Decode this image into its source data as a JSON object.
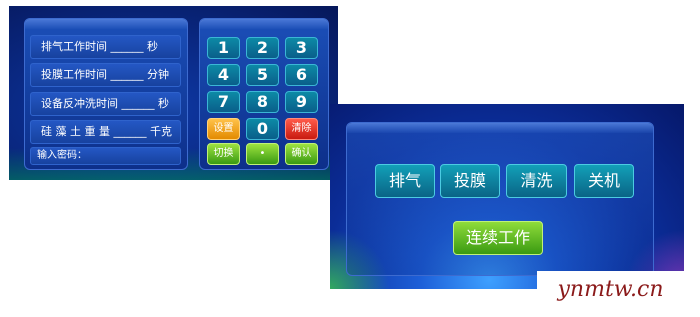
{
  "panel1": {
    "fields": [
      "排气工作时间 ______ 秒",
      "投膜工作时间 ______ 分钟",
      "设备反冲洗时间 ______ 秒",
      "硅 藻 土 重 量 ______ 千克"
    ],
    "password_label": "输入密码：",
    "keypad": {
      "k1": "1",
      "k2": "2",
      "k3": "3",
      "k4": "4",
      "k5": "5",
      "k6": "6",
      "k7": "7",
      "k8": "8",
      "k9": "9",
      "set": "设置",
      "k0": "0",
      "clear": "清除",
      "switch": "切换",
      "dot": "•",
      "confirm": "确认"
    },
    "colors": {
      "bg": "#0a2a86",
      "key": "#0c8aa6",
      "set": "#f0a020",
      "clear": "#e0301c",
      "green": "#5ab820"
    }
  },
  "panel2": {
    "buttons": {
      "exhaust": "排气",
      "film": "投膜",
      "clean": "清洗",
      "shutdown": "关机"
    },
    "continuous": "连续工作"
  },
  "watermark": "ynmtw.cn"
}
